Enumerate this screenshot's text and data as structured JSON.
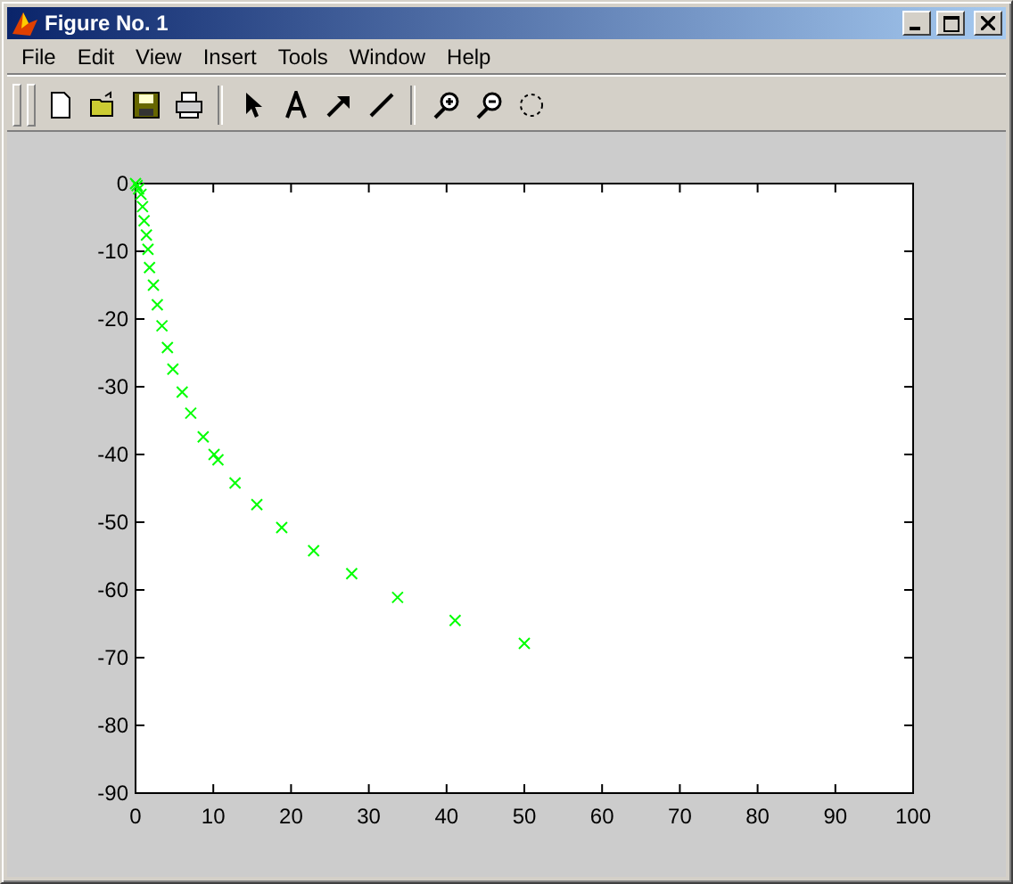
{
  "window": {
    "title": "Figure No. 1"
  },
  "menu": [
    "File",
    "Edit",
    "View",
    "Insert",
    "Tools",
    "Window",
    "Help"
  ],
  "figure": {
    "chart_data": {
      "type": "scatter",
      "xlim": [
        0,
        100
      ],
      "ylim": [
        -90,
        0
      ],
      "xticks": [
        0,
        10,
        20,
        30,
        40,
        50,
        60,
        70,
        80,
        90,
        100
      ],
      "yticks": [
        -90,
        -80,
        -70,
        -60,
        -50,
        -40,
        -30,
        -20,
        -10,
        0
      ],
      "series": [
        {
          "color": "#00ff00",
          "x": [
            0,
            0.2,
            0.4,
            0.7,
            0.9,
            1.1,
            1.4,
            1.6,
            1.8,
            2.3,
            2.8,
            3.4,
            4.1,
            4.8,
            6,
            7.1,
            8.7,
            10.1,
            10.6,
            12.8,
            15.6,
            18.8,
            22.9,
            27.8,
            33.7,
            41.1,
            50
          ],
          "values": [
            0,
            -0.3,
            -0.8,
            -1.6,
            -3.4,
            -5.5,
            -7.6,
            -9.7,
            -12.4,
            -15,
            -17.9,
            -21,
            -24.2,
            -27.4,
            -30.8,
            -33.9,
            -37.4,
            -40,
            -40.8,
            -44.2,
            -47.4,
            -50.8,
            -54.2,
            -57.6,
            -61.1,
            -64.5,
            -67.9
          ]
        }
      ]
    }
  }
}
